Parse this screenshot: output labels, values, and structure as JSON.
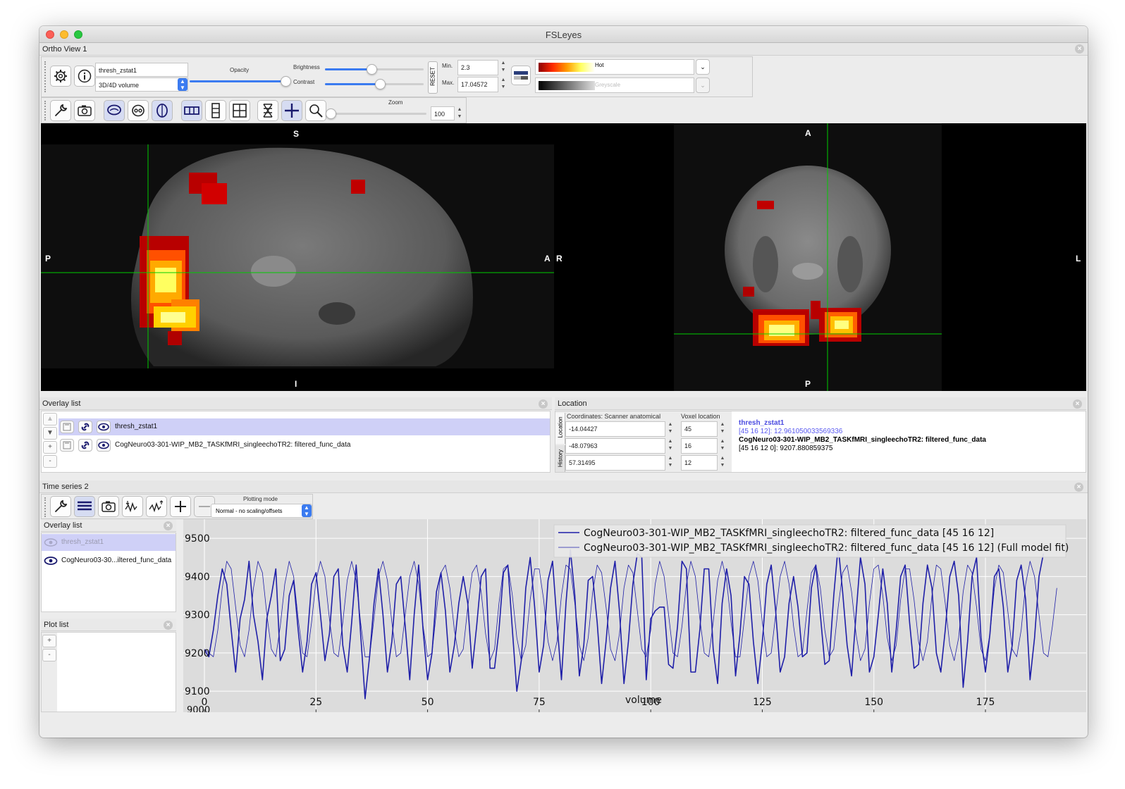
{
  "window": {
    "title": "FSLeyes"
  },
  "ortho": {
    "panel_title": "Ortho View 1",
    "overlay_name": "thresh_zstat1",
    "overlay_type": "3D/4D volume",
    "opacity_label": "Opacity",
    "brightness_label": "Brightness",
    "contrast_label": "Contrast",
    "reset_label": "RESET",
    "min_label": "Min.",
    "max_label": "Max.",
    "min_value": "2.3",
    "max_value": "17.04572",
    "cmap_primary": "Hot",
    "cmap_secondary": "Greyscale",
    "zoom_label": "Zoom",
    "zoom_value": "100",
    "opacity": 0.97,
    "brightness": 0.47,
    "contrast": 0.56,
    "zoom": 0.0,
    "sagittal_labels": {
      "top": "S",
      "bottom": "I",
      "left": "P",
      "right": "A"
    },
    "axial_labels": {
      "top": "A",
      "bottom": "P",
      "left": "R",
      "right": "L"
    }
  },
  "overlay_list": {
    "title": "Overlay list",
    "items": [
      {
        "name": "thresh_zstat1",
        "selected": true
      },
      {
        "name": "CogNeuro03-301-WIP_MB2_TASKfMRI_singleechoTR2: filtered_func_data",
        "selected": false
      }
    ],
    "controls": [
      "▲",
      "▼",
      "+",
      "-"
    ]
  },
  "location": {
    "title": "Location",
    "tab_location": "Location",
    "tab_history": "History",
    "coords_header": "Coordinates: Scanner anatomical",
    "voxel_header": "Voxel location",
    "coords": [
      "-14.04427",
      "-48.07963",
      "57.31495"
    ],
    "voxels": [
      "45",
      "16",
      "12"
    ],
    "info": {
      "overlay1_name": "thresh_zstat1",
      "overlay1_value": "[45 16 12]: 12.961050033569336",
      "overlay2_name": "CogNeuro03-301-WIP_MB2_TASKfMRI_singleechoTR2: filtered_func_data",
      "overlay2_value": "[45 16 12 0]: 9207.880859375"
    }
  },
  "timeseries": {
    "panel_title": "Time series 2",
    "plotting_mode_label": "Plotting mode",
    "plotting_mode_value": "Normal - no scaling/offsets",
    "overlay_list_title": "Overlay list",
    "overlays": [
      {
        "name": "thresh_zstat1",
        "enabled": false
      },
      {
        "name": "CogNeuro03-30...iltered_func_data",
        "enabled": true
      }
    ],
    "plot_list_title": "Plot list",
    "plot_controls": [
      "+",
      "-"
    ],
    "clipped_tick": "9000"
  },
  "colors": {
    "series": "#1f1fa8",
    "selection": "#cfd0f7",
    "crosshair": "#00cc00",
    "accent": "#3b7bf0"
  },
  "chart_data": {
    "type": "line",
    "title": "",
    "xlabel": "volume",
    "ylabel": "",
    "xlim": [
      0,
      193
    ],
    "ylim": [
      9045,
      9550
    ],
    "xticks": [
      0,
      25,
      50,
      75,
      100,
      125,
      150,
      175
    ],
    "yticks": [
      9100,
      9200,
      9300,
      9400,
      9500
    ],
    "grid": true,
    "legend_position": "top-right",
    "series": [
      {
        "name": "CogNeuro03-301-WIP_MB2_TASKfMRI_singleechoTR2: filtered_func_data [45 16 12]",
        "width": 1.6,
        "values": [
          9208,
          9190,
          9260,
          9350,
          9420,
          9380,
          9260,
          9150,
          9290,
          9340,
          9440,
          9300,
          9230,
          9130,
          9290,
          9350,
          9420,
          9180,
          9210,
          9350,
          9390,
          9260,
          9150,
          9230,
          9380,
          9410,
          9300,
          9180,
          9250,
          9400,
          9420,
          9220,
          9150,
          9280,
          9430,
          9250,
          9080,
          9190,
          9330,
          9420,
          9300,
          9150,
          9230,
          9380,
          9400,
          9270,
          9130,
          9300,
          9430,
          9260,
          9130,
          9200,
          9360,
          9410,
          9310,
          9150,
          9220,
          9330,
          9400,
          9330,
          9160,
          9270,
          9400,
          9420,
          9160,
          9160,
          9260,
          9410,
          9430,
          9260,
          9100,
          9180,
          9370,
          9450,
          9320,
          9150,
          9220,
          9390,
          9440,
          9280,
          9130,
          9330,
          9470,
          9350,
          9140,
          9220,
          9390,
          9400,
          9280,
          9120,
          9230,
          9370,
          9440,
          9310,
          9120,
          9230,
          9380,
          9460,
          9450,
          9130,
          9290,
          9310,
          9320,
          9320,
          9170,
          9160,
          9270,
          9440,
          9420,
          9150,
          9150,
          9260,
          9420,
          9420,
          9210,
          9120,
          9330,
          9420,
          9350,
          9140,
          9250,
          9400,
          9380,
          9230,
          9120,
          9230,
          9380,
          9430,
          9310,
          9150,
          9190,
          9330,
          9400,
          9320,
          9190,
          9200,
          9370,
          9430,
          9300,
          9170,
          9180,
          9350,
          9480,
          9360,
          9220,
          9140,
          9300,
          9450,
          9380,
          9150,
          9190,
          9300,
          9420,
          9330,
          9150,
          9260,
          9400,
          9430,
          9280,
          9160,
          9170,
          9330,
          9430,
          9370,
          9200,
          9150,
          9260,
          9400,
          9440,
          9350,
          9110,
          9230,
          9400,
          9450,
          9240,
          9150,
          9250,
          9400,
          9420,
          9320,
          9150,
          9220,
          9390,
          9430,
          9340,
          9130,
          9240,
          9400,
          9460
        ]
      },
      {
        "name": "CogNeuro03-301-WIP_MB2_TASKfMRI_singleechoTR2: filtered_func_data [45 16 12] (Full model fit)",
        "width": 0.8,
        "values": [
          9210,
          9200,
          9190,
          9260,
          9370,
          9440,
          9420,
          9320,
          9220,
          9190,
          9260,
          9370,
          9440,
          9410,
          9300,
          9210,
          9190,
          9270,
          9380,
          9440,
          9400,
          9290,
          9200,
          9190,
          9280,
          9390,
          9440,
          9400,
          9290,
          9200,
          9190,
          9280,
          9390,
          9440,
          9390,
          9280,
          9190,
          9190,
          9290,
          9400,
          9440,
          9390,
          9280,
          9190,
          9200,
          9300,
          9400,
          9440,
          9380,
          9270,
          9190,
          9200,
          9310,
          9410,
          9430,
          9370,
          9260,
          9190,
          9210,
          9320,
          9410,
          9430,
          9360,
          9250,
          9180,
          9210,
          9330,
          9420,
          9430,
          9350,
          9240,
          9180,
          9220,
          9340,
          9420,
          9420,
          9340,
          9230,
          9180,
          9230,
          9350,
          9430,
          9420,
          9330,
          9220,
          9180,
          9240,
          9360,
          9430,
          9410,
          9320,
          9210,
          9180,
          9250,
          9370,
          9430,
          9410,
          9310,
          9210,
          9190,
          9260,
          9380,
          9440,
          9400,
          9300,
          9200,
          9190,
          9270,
          9380,
          9440,
          9400,
          9290,
          9200,
          9190,
          9280,
          9390,
          9440,
          9390,
          9280,
          9190,
          9190,
          9290,
          9400,
          9440,
          9390,
          9280,
          9190,
          9200,
          9300,
          9400,
          9440,
          9380,
          9270,
          9190,
          9200,
          9310,
          9410,
          9430,
          9370,
          9260,
          9190,
          9210,
          9320,
          9410,
          9430,
          9360,
          9250,
          9180,
          9210,
          9330,
          9420,
          9430,
          9350,
          9240,
          9180,
          9220,
          9340,
          9420,
          9420,
          9340,
          9230,
          9180,
          9230,
          9350,
          9430,
          9420,
          9330,
          9220,
          9180,
          9240,
          9360,
          9430,
          9410,
          9320,
          9210,
          9180,
          9250,
          9370,
          9430,
          9410,
          9310,
          9210,
          9190,
          9260,
          9380,
          9440,
          9400,
          9300,
          9200,
          9190,
          9270,
          9370
        ]
      }
    ]
  }
}
